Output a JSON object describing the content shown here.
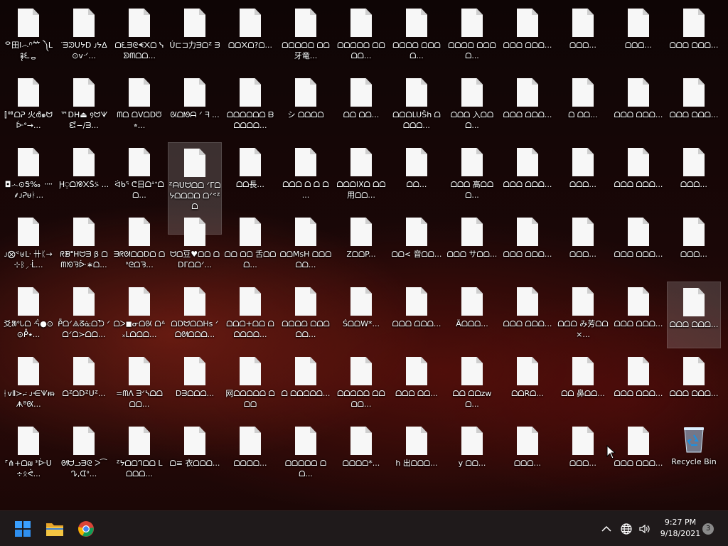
{
  "desktop": {
    "icons": [
      {
        "label": "ᄋ⽥ⅼ෴ᣕ⺮ ༽ᒪ࿑ᘍᇹ",
        "selected": false
      },
      {
        "label": "⫿ᅋᗝᕈ 火ർ๑ᗢᐕᐤ→...",
        "selected": false
      },
      {
        "label": "◘෴⊙Ꭶ‰ ᠁⸙ᴊᕈᵾᛓ...",
        "selected": false
      },
      {
        "label": "ᴊ⨂ᕝ⊎ᒷ 卄ᛕ→⊹ᛒ⸝ᒸ...",
        "selected": false
      },
      {
        "label": "⽘ᱟᐤᘂᗝ ᕎ●⊙⊙ᑬ⭑...",
        "selected": false
      },
      {
        "label": "ᚽᴠⅡ≻⨬ ᴊ⋲ᗐᵯᗗᴮᘡ...",
        "selected": false
      },
      {
        "label": "ᣘ⋔+ᗝ໙ ᕑᐕᑌ÷ᛟᕚ...",
        "selected": false
      },
      {
        "label": "ᐝᗱᙄᑌᔭᗞ ᴊᔭᐃ⊙ᴠᐧᐟ...",
        "selected": false
      },
      {
        "label": "™ᗞᕼ⏏ ᠀ᗢᗐᘿ−/ᗱ...",
        "selected": false
      },
      {
        "label": "Ḩ⍜ᗝᘠ᙭Š⍩ ...",
        "selected": false
      },
      {
        "label": "ᖇᗾᙿHᗢᗱ β ᗝᗰᘞᘋᐕ∗ᗝ...",
        "selected": false
      },
      {
        "label": "ᑬᗝᐟ⟁ᘔᓎᗝᘪ ᐟᗝᐟᗝ≻ᗝᗝ...",
        "selected": false
      },
      {
        "label": "ᗝᙆᗝᗞᙆᑌᙆ...",
        "selected": false
      },
      {
        "label": "ᘛᗨᓗᗱᘓ ᐳ⁀ᖊ,ᗭᐤ...",
        "selected": false
      },
      {
        "label": "ᗝᘍᗱᘓᗛ᙭ᗝ ᓭᗥᗰᗝᗝ...",
        "selected": false
      },
      {
        "label": "ᗰᗝ ᗝᐯᗝᗞᙈ⭒...",
        "selected": false
      },
      {
        "label": "ᐛᑲᕐ ᕦ日ᗝᗮᕀᗝᗝ...",
        "selected": false
      },
      {
        "label": "ᗱᖇᘛᗝᗝᗞᗝ ᗝᐤᘓᗝᘋ...",
        "selected": false
      },
      {
        "label": "ᗝᐳ◼ᓂᗝᘡ ᗝᐞ᙮ᒪᗝᗝᗝ...",
        "selected": false
      },
      {
        "label": "=ᗰᐱ ᗱᐟᓴᗝᗝᗝᗝ...",
        "selected": false
      },
      {
        "label": "ᙆᔭᗝᗝᒉᗝᗝ ᒪᗝᗝᗝ...",
        "selected": false
      },
      {
        "label": "Ú⊏⊐力ᗱᗝᙆ ᗱ",
        "selected": false
      },
      {
        "label": "ᘡᗝᘚᗩ ᐟ ᖷ ...",
        "selected": false
      },
      {
        "label": "ᙆᗩᑌᗢᗝᗝ ᐟᒥᗝᔭᗝᗝᗝᗝ ᗝᐟᕝᙆᗝ",
        "selected": true
      },
      {
        "label": "ᗢᗝ豆♥ᗝᗝ ᗝᗞᒥᗝᗝᐟ...",
        "selected": false
      },
      {
        "label": "ᗝᗞᗢᗝᗝHs ᐟᗝᘛᗝᗝᗝ...",
        "selected": false
      },
      {
        "label": "ᗞᗱᗝᗝᗝ...",
        "selected": false
      },
      {
        "label": "ᗝ≡ 衣ᗝᗝᗝ...",
        "selected": false
      },
      {
        "label": "ᗝᗝ᙭ᗝ?ᗝ...",
        "selected": false
      },
      {
        "label": "ᗝᗝᗝᗝᗝᗝ ᗷᗝᗝᗝᗝ...",
        "selected": false
      },
      {
        "label": "ᗝᗝ長...",
        "selected": false
      },
      {
        "label": "ᗝᗝ ᗝᗝ 舌ᗝᗝᗝ...",
        "selected": false
      },
      {
        "label": "ᗝᗝᗝ+ᗝᗝ ᗝᗝᗝᗝᗝ...",
        "selected": false
      },
      {
        "label": "网ᗝᗝᗝᗝᗝ ᗝᗝᗝ",
        "selected": false
      },
      {
        "label": "ᗝᗝᗝᗝ...",
        "selected": false
      },
      {
        "label": "ᗝᗝᗝᗝᗝ ᗝᗝ牙竜...",
        "selected": false
      },
      {
        "label": "シ ᗝᗝᗝᗝ",
        "selected": false
      },
      {
        "label": "ᗝᗝᗝ ᗝ ᗝ ᗝ ...",
        "selected": false
      },
      {
        "label": "ᗝᗝMsH ᗝᗝᗝᗝᗝ...",
        "selected": false
      },
      {
        "label": "ᗝᗝᗝᗝ ᗝᗝᗝᗝᗝ...",
        "selected": false
      },
      {
        "label": "ᗝ ᗝᗝᗝᗝᗝ...",
        "selected": false
      },
      {
        "label": "ᗝᗝᗝᗝᗝ ᗝᗝ...",
        "selected": false
      },
      {
        "label": "ᗝᗝᗝᗝᗝ ᗝᗝᗝᗝ...",
        "selected": false
      },
      {
        "label": "ᗝᗝ ᗝᗝ...",
        "selected": false
      },
      {
        "label": "ᗝᗝᗝIXᗝ ᗝᗝ用ᗝᗝ...",
        "selected": false
      },
      {
        "label": "ZᗝᗝP...",
        "selected": false
      },
      {
        "label": "ŚᗝᗝW*...",
        "selected": false
      },
      {
        "label": "ᗝᗝᗝᗝᗝ ᗝᗝᗝᗝ...",
        "selected": false
      },
      {
        "label": "ᗝᗝᗝᗝ*...",
        "selected": false
      },
      {
        "label": "ᗝᗝᗝᗝ ᗝᗝᗝᗝ...",
        "selected": false
      },
      {
        "label": "ᗝᗝᗝLUŠh ᗝᗝᗝᗝ...",
        "selected": false
      },
      {
        "label": "ᗝᗝ...",
        "selected": false
      },
      {
        "label": "ᗝᗝ< 音ᗝᗝ...",
        "selected": false
      },
      {
        "label": "ᗝᗝᗝ ᗝᗝᗝ...",
        "selected": false
      },
      {
        "label": "ᗝᗝᗝ ᗝᗝ...",
        "selected": false
      },
      {
        "label": "h 出ᗝᗝᗝ...",
        "selected": false
      },
      {
        "label": "ᗝᗝᗝᗝ ᗝᗝᗝᗝ...",
        "selected": false
      },
      {
        "label": "ᗝᗝᗝ 入ᗝᗝᗝ...",
        "selected": false
      },
      {
        "label": "ᗝᗝᗝ 高ᗝᗝᗝ...",
        "selected": false
      },
      {
        "label": "ᗝᗝᗝ サᗝᗝ...",
        "selected": false
      },
      {
        "label": "Äᗝᗝᗝ...",
        "selected": false
      },
      {
        "label": "ᗝᗝ ᗝᗝzwᗝ...",
        "selected": false
      },
      {
        "label": "y ᗝᗝ...",
        "selected": false
      },
      {
        "label": "ᗝᗝᗝ ᗝᗝᗝ...",
        "selected": false
      },
      {
        "label": "ᗝᗝᗝ ᗝᗝᗝ...",
        "selected": false
      },
      {
        "label": "ᗝᗝᗝ ᗝᗝᗝ...",
        "selected": false
      },
      {
        "label": "ᗝᗝᗝ ᗝᗝᗝ...",
        "selected": false
      },
      {
        "label": "ᗝᗝᗝ ᗝᗝᗝ...",
        "selected": false
      },
      {
        "label": "ᗝᗝRᗝ...",
        "selected": false
      },
      {
        "label": "ᗝᗝᗝ...",
        "selected": false
      },
      {
        "label": "ᗝᗝᗝ...",
        "selected": false
      },
      {
        "label": "ᗝ ᗝᗝ...",
        "selected": false
      },
      {
        "label": "ᗝᗝᗝ...",
        "selected": false
      },
      {
        "label": "ᗝᗝᗝ...",
        "selected": false
      },
      {
        "label": "ᗝᗝᗝ み芳ᗝᗝ×...",
        "selected": false
      },
      {
        "label": "ᗝᗝ 鼻ᗝᗝ...",
        "selected": false
      },
      {
        "label": "ᗝᗝᗝ...",
        "selected": false
      },
      {
        "label": "ᗝᗝᗝ...",
        "selected": false
      },
      {
        "label": "ᗝᗝᗝ ᗝᗝᗝ...",
        "selected": false
      },
      {
        "label": "ᗝᗝᗝ ᗝᗝᗝ...",
        "selected": false
      },
      {
        "label": "ᗝᗝᗝ ᗝᗝᗝ...",
        "selected": false
      },
      {
        "label": "ᗝᗝᗝ ᗝᗝᗝ...",
        "selected": false
      },
      {
        "label": "ᗝᗝᗝ ᗝᗝᗝ...",
        "selected": false
      },
      {
        "label": "ᗝᗝᗝ ᗝᗝᗝ...",
        "selected": false
      },
      {
        "label": "ᗝᗝᗝ ᗝᗝᗝ...",
        "selected": false
      },
      {
        "label": "ᗝᗝᗝ ᗝᗝᗝ...",
        "selected": false
      },
      {
        "label": "ᗝᗝᗝ...",
        "selected": false
      },
      {
        "label": "ᗝᗝᗝ...",
        "selected": false
      },
      {
        "label": "ᗝᗝᗝ ᗝᗝᗝ...",
        "selected": true
      },
      {
        "label": "ᗝᗝᗝ ᗝᗝᗝ...",
        "selected": false
      }
    ],
    "recycle_bin": {
      "label": "Recycle Bin"
    }
  },
  "taskbar": {
    "start_icon": "windows-start-icon",
    "pinned": [
      {
        "name": "file-explorer-icon"
      },
      {
        "name": "chrome-icon"
      }
    ],
    "tray": {
      "time": "9:27 PM",
      "date": "9/18/2021",
      "notification_count": "3"
    }
  },
  "colors": {
    "taskbar_bg": "#1f1a1b",
    "start_blue": "#2f8ff0",
    "folder_yellow": "#f4c542"
  }
}
